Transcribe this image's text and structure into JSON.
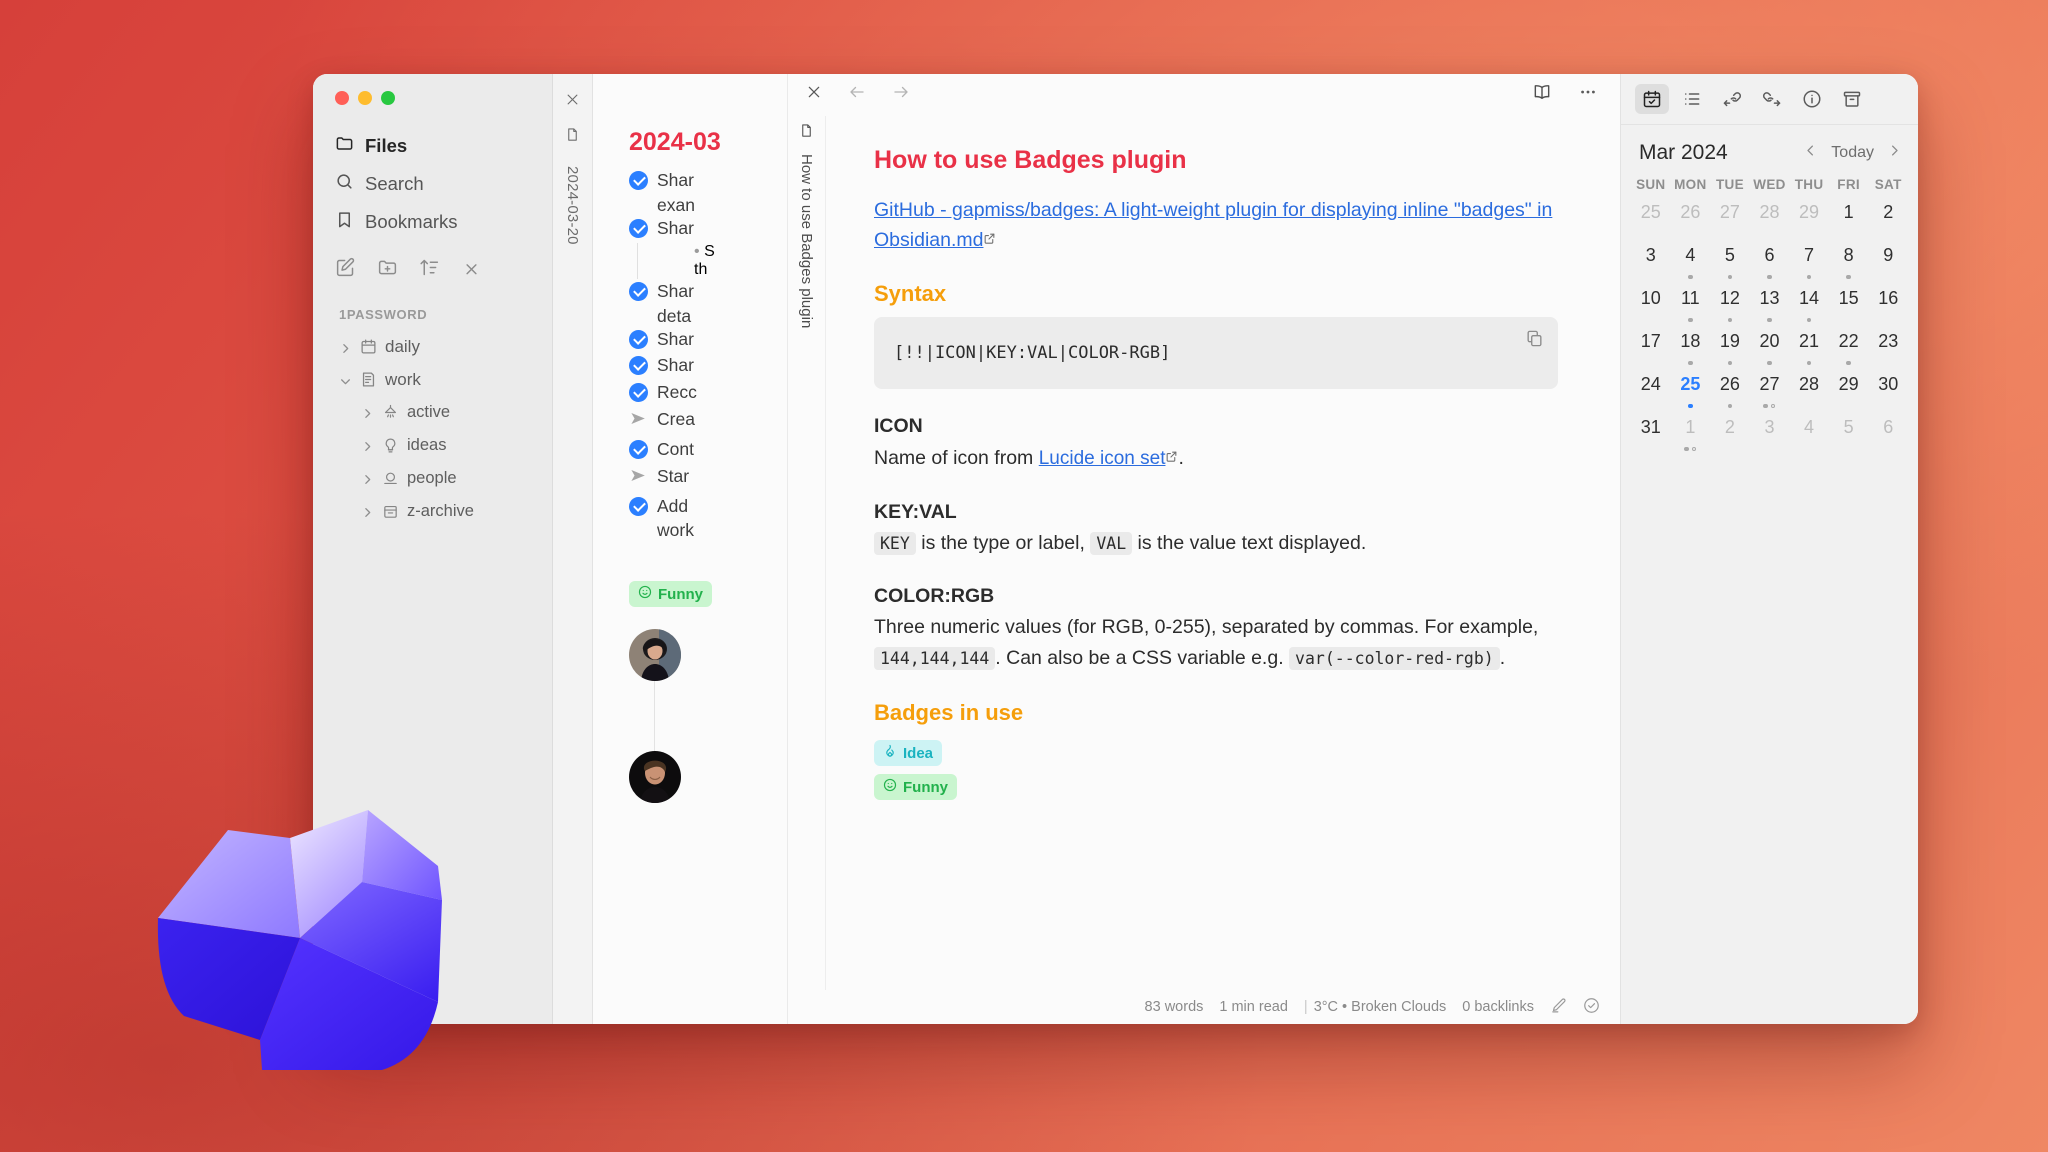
{
  "window": {
    "traffic_lights": [
      "close",
      "minimize",
      "zoom"
    ]
  },
  "sidebar": {
    "nav": [
      {
        "label": "Files",
        "icon": "folder-icon",
        "active": true
      },
      {
        "label": "Search",
        "icon": "search-icon",
        "active": false
      },
      {
        "label": "Bookmarks",
        "icon": "bookmark-icon",
        "active": false
      }
    ],
    "tools": [
      {
        "name": "new-note-icon"
      },
      {
        "name": "new-folder-icon"
      },
      {
        "name": "sort-icon"
      },
      {
        "name": "collapse-all-icon"
      }
    ],
    "vault_label": "1PASSWORD",
    "tree": [
      {
        "label": "daily",
        "icon": "calendar-icon",
        "expanded": false,
        "depth": 0
      },
      {
        "label": "work",
        "icon": "file-text-icon",
        "expanded": true,
        "depth": 0
      },
      {
        "label": "active",
        "icon": "lamp-icon",
        "expanded": false,
        "depth": 1
      },
      {
        "label": "ideas",
        "icon": "lightbulb-icon",
        "expanded": false,
        "depth": 1
      },
      {
        "label": "people",
        "icon": "user-icon",
        "expanded": false,
        "depth": 1
      },
      {
        "label": "z-archive",
        "icon": "archive-icon",
        "expanded": false,
        "depth": 1
      }
    ]
  },
  "daily_pane": {
    "tab_label": "2024-03-20",
    "title": "2024-03",
    "tasks": [
      {
        "state": "done",
        "text": "Shar",
        "wrap": "exan"
      },
      {
        "state": "done",
        "text": "Shar",
        "sub": "S",
        "sub_wrap": "th"
      },
      {
        "state": "done",
        "text": "Shar",
        "wrap": "deta"
      },
      {
        "state": "done",
        "text": "Shar"
      },
      {
        "state": "done",
        "text": "Shar"
      },
      {
        "state": "done",
        "text": "Recc"
      },
      {
        "state": "forwarded",
        "text": "Crea"
      },
      {
        "state": "done",
        "text": "Cont"
      },
      {
        "state": "forwarded",
        "text": "Star"
      },
      {
        "state": "done",
        "text": "Add",
        "wrap": "work"
      }
    ],
    "badge": {
      "label": "Funny",
      "icon": "smile-icon"
    },
    "avatars": [
      "avatar-person-1",
      "avatar-person-2"
    ]
  },
  "note_pane": {
    "toolbar": {
      "close": "close-icon",
      "back": "back-icon",
      "forward": "forward-icon",
      "reading_view": "book-open-icon",
      "more": "more-options-icon"
    },
    "tab_label": "How to use Badges plugin",
    "title": "How to use Badges plugin",
    "link": {
      "text": "GitHub - gapmiss/badges: A light-weight plugin for displaying inline \"badges\" in Obsidian.md",
      "external_icon": "external-link-icon"
    },
    "sections": [
      {
        "heading": "Syntax",
        "heading_level": 2,
        "code": "[!!|ICON|KEY:VAL|COLOR-RGB]",
        "copy_icon": "copy-icon"
      },
      {
        "heading": "ICON",
        "heading_level": 3,
        "body_before": "Name of icon from ",
        "body_link": "Lucide icon set",
        "body_after": "."
      },
      {
        "heading": "KEY:VAL",
        "heading_level": 3,
        "code_1": "KEY",
        "text_1": " is the type or label, ",
        "code_2": "VAL",
        "text_2": " is the value text displayed."
      },
      {
        "heading": "COLOR:RGB",
        "heading_level": 3,
        "text_1": "Three numeric values (for RGB, 0-255), separated by commas. For example,",
        "code_1": "144,144,144",
        "text_2": ". Can also be a CSS variable e.g. ",
        "code_2": "var(--color-red-rgb)",
        "text_3": "."
      },
      {
        "heading": "Badges in use",
        "heading_level": 2,
        "badges": [
          {
            "label": "Idea",
            "icon": "flame-icon",
            "color": "cyan"
          },
          {
            "label": "Funny",
            "icon": "smile-icon",
            "color": "green"
          }
        ]
      }
    ],
    "status": {
      "words": "83 words",
      "read_time": "1 min read",
      "weather": "3°C • Broken Clouds",
      "backlinks": "0 backlinks",
      "edit_icon": "pencil-icon",
      "check_icon": "check-circle-icon"
    }
  },
  "calendar_pane": {
    "tabs": [
      {
        "name": "calendar-tab",
        "icon": "calendar-check-icon",
        "selected": true
      },
      {
        "name": "outline-tab",
        "icon": "list-icon",
        "selected": false
      },
      {
        "name": "backlinks-tab",
        "icon": "link-incoming-icon",
        "selected": false
      },
      {
        "name": "outgoing-links-tab",
        "icon": "link-outgoing-icon",
        "selected": false
      },
      {
        "name": "info-tab",
        "icon": "info-icon",
        "selected": false
      },
      {
        "name": "archive-tab",
        "icon": "archive-box-icon",
        "selected": false
      }
    ],
    "month": "Mar 2024",
    "today_label": "Today",
    "prev_icon": "chevron-left-icon",
    "next_icon": "chevron-right-icon",
    "dow": [
      "SUN",
      "MON",
      "TUE",
      "WED",
      "THU",
      "FRI",
      "SAT"
    ],
    "weeks": [
      [
        {
          "d": "25",
          "muted": true
        },
        {
          "d": "26",
          "muted": true
        },
        {
          "d": "27",
          "muted": true
        },
        {
          "d": "28",
          "muted": true
        },
        {
          "d": "29",
          "muted": true
        },
        {
          "d": "1"
        },
        {
          "d": "2"
        }
      ],
      [
        {
          "d": "3"
        },
        {
          "d": "4",
          "dots": [
            "filled"
          ]
        },
        {
          "d": "5",
          "dots": [
            "filled"
          ]
        },
        {
          "d": "6",
          "dots": [
            "filled"
          ]
        },
        {
          "d": "7",
          "dots": [
            "filled"
          ]
        },
        {
          "d": "8",
          "dots": [
            "filled"
          ]
        },
        {
          "d": "9"
        }
      ],
      [
        {
          "d": "10"
        },
        {
          "d": "11",
          "dots": [
            "filled"
          ]
        },
        {
          "d": "12",
          "dots": [
            "filled"
          ]
        },
        {
          "d": "13",
          "dots": [
            "filled"
          ]
        },
        {
          "d": "14",
          "dots": [
            "filled"
          ]
        },
        {
          "d": "15"
        },
        {
          "d": "16"
        }
      ],
      [
        {
          "d": "17"
        },
        {
          "d": "18",
          "dots": [
            "filled"
          ]
        },
        {
          "d": "19",
          "dots": [
            "filled"
          ]
        },
        {
          "d": "20",
          "dots": [
            "filled"
          ]
        },
        {
          "d": "21",
          "dots": [
            "filled"
          ]
        },
        {
          "d": "22",
          "dots": [
            "filled"
          ]
        },
        {
          "d": "23"
        }
      ],
      [
        {
          "d": "24"
        },
        {
          "d": "25",
          "selected": true,
          "dots": [
            "blue"
          ]
        },
        {
          "d": "26",
          "dots": [
            "filled"
          ]
        },
        {
          "d": "27",
          "dots": [
            "filled",
            "hollow"
          ]
        },
        {
          "d": "28"
        },
        {
          "d": "29"
        },
        {
          "d": "30"
        }
      ],
      [
        {
          "d": "31"
        },
        {
          "d": "1",
          "muted": true,
          "dots": [
            "filled",
            "hollow"
          ]
        },
        {
          "d": "2",
          "muted": true
        },
        {
          "d": "3",
          "muted": true
        },
        {
          "d": "4",
          "muted": true
        },
        {
          "d": "5",
          "muted": true
        },
        {
          "d": "6",
          "muted": true
        }
      ]
    ]
  },
  "colors": {
    "accent_red": "#e93147",
    "accent_orange": "#f59e0b",
    "link_blue": "#2b6cde",
    "check_blue": "#2b7fff",
    "badge_green_bg": "#c9f5cf",
    "badge_green_fg": "#22b14c",
    "badge_cyan_bg": "#cdf3f4",
    "badge_cyan_fg": "#1ab3c0",
    "desktop_bg": "#dd4f42"
  }
}
